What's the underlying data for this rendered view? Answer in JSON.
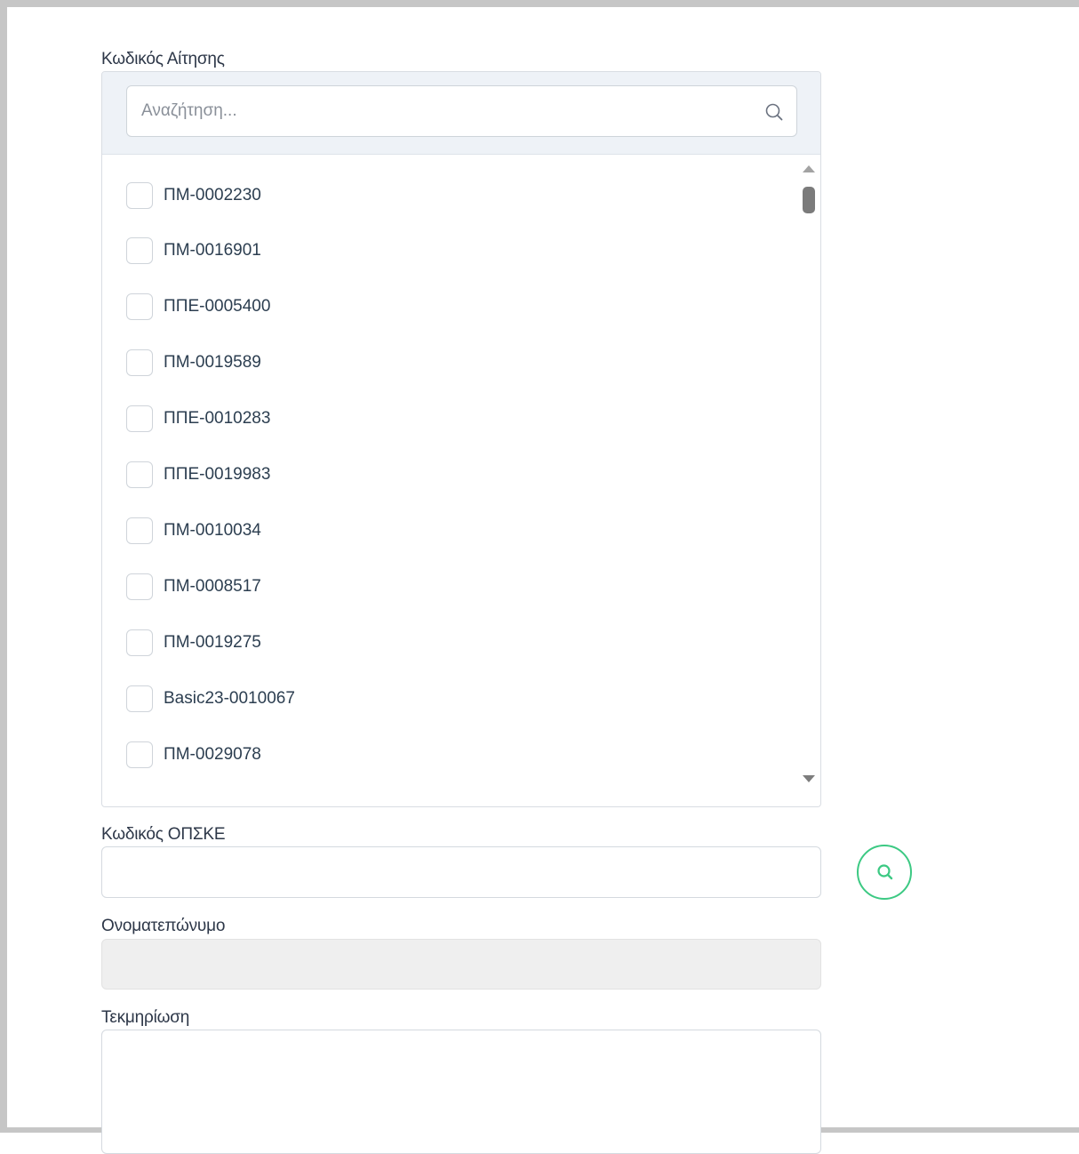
{
  "labels": {
    "request_code": "Κωδικός Αίτησης",
    "opske_code": "Κωδικός ΟΠΣΚΕ",
    "full_name": "Ονοματεπώνυμο",
    "documentation": "Τεκμηρίωση"
  },
  "multiselect": {
    "search_placeholder": "Αναζήτηση...",
    "search_value": "",
    "options": [
      {
        "label": "ΠΜ-0002230",
        "checked": false
      },
      {
        "label": "ΠΜ-0016901",
        "checked": false
      },
      {
        "label": "ΠΠΕ-0005400",
        "checked": false
      },
      {
        "label": "ΠΜ-0019589",
        "checked": false
      },
      {
        "label": "ΠΠΕ-0010283",
        "checked": false
      },
      {
        "label": "ΠΠΕ-0019983",
        "checked": false
      },
      {
        "label": "ΠΜ-0010034",
        "checked": false
      },
      {
        "label": "ΠΜ-0008517",
        "checked": false
      },
      {
        "label": "ΠΜ-0019275",
        "checked": false
      },
      {
        "label": "Basic23-0010067",
        "checked": false
      },
      {
        "label": "ΠΜ-0029078",
        "checked": false
      }
    ]
  },
  "fields": {
    "opske_value": "",
    "full_name_value": "",
    "documentation_value": ""
  },
  "icons": {
    "search_field_icon": "search-icon",
    "opske_button_icon": "search-icon"
  },
  "colors": {
    "accent_green": "#3cc983",
    "header_bg": "#eef2f7",
    "disabled_bg": "#efefef"
  }
}
